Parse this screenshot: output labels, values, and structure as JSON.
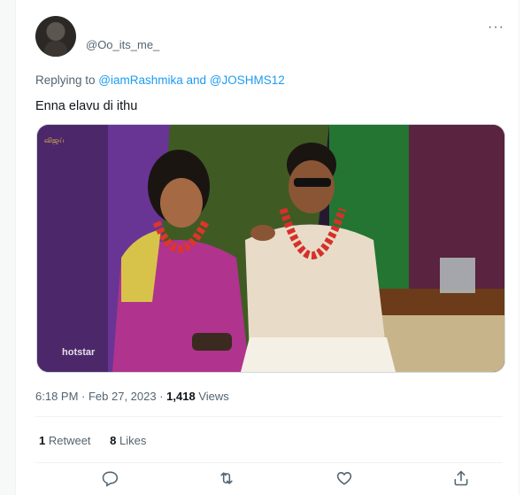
{
  "tweet": {
    "handle": "@Oo_its_me_",
    "more_label": "···",
    "reply_prefix": "Replying to ",
    "mention_1": "@iamRashmika",
    "reply_and": " and ",
    "mention_2": "@JOSHMS12",
    "text": "Enna elavu di ithu",
    "time": "6:18 PM",
    "sep": " · ",
    "date": "Feb 27, 2023",
    "views_count": "1,418",
    "views_label": " Views",
    "retweets_count": "1",
    "retweets_label": " Retweet",
    "likes_count": "8",
    "likes_label": " Likes"
  },
  "media": {
    "watermark": "hotstar",
    "channel": "விஜய்"
  },
  "colors": {
    "accent": "#1d9bf0",
    "secondary_text": "#536471"
  },
  "icons": [
    "avatar",
    "more-icon",
    "reply-icon",
    "retweet-icon",
    "like-icon",
    "share-icon"
  ]
}
